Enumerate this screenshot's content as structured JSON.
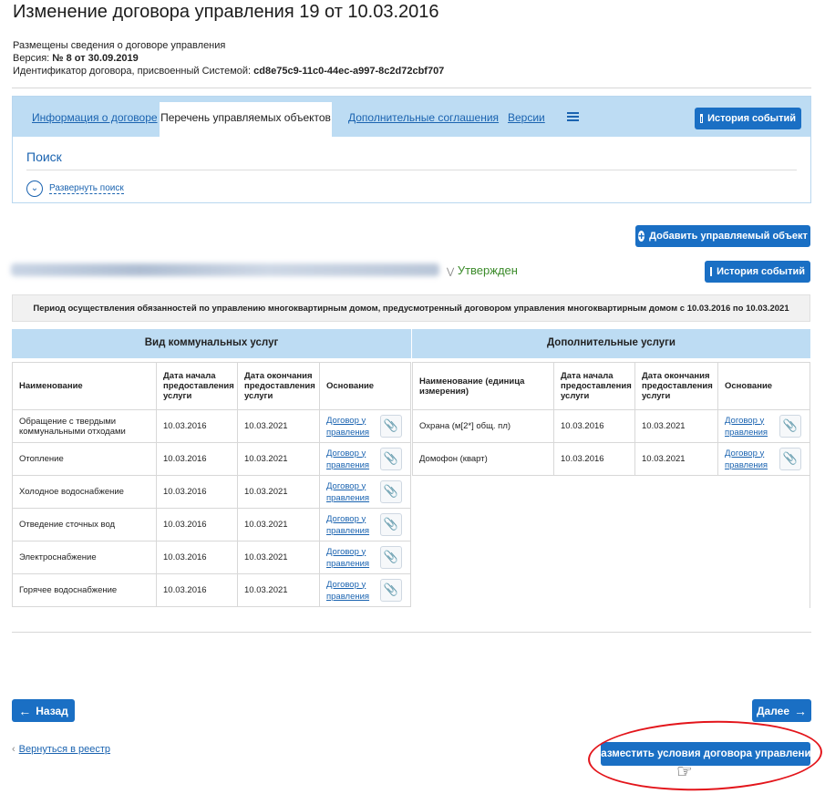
{
  "header": {
    "title": "Изменение договора управления 19 от 10.03.2016",
    "info_line": "Размещены сведения о договоре управления",
    "version_label": "Версия: ",
    "version_value": "№ 8 от 30.09.2019",
    "id_label": "Идентификатор договора, присвоенный Системой: ",
    "id_value": "cd8e75c9-11c0-44ec-a997-8c2d72cbf707"
  },
  "tabs": {
    "info": "Информация о договоре",
    "objects": "Перечень управляемых объектов",
    "agreements": "Дополнительные соглашения",
    "versions": "Версии",
    "history_button": "История событий"
  },
  "search": {
    "title": "Поиск",
    "expand": "Развернуть поиск"
  },
  "objects": {
    "add_button": "Добавить управляемый объект",
    "status": "Утвержден",
    "history_button": "История событий",
    "period": "Период осуществления обязанностей по управлению многоквартирным домом, предусмотренный договором управления многоквартирным домом с 10.03.2016 по 10.03.2021"
  },
  "communal": {
    "title": "Вид коммунальных услуг",
    "columns": [
      "Наименование",
      "Дата начала предоставления услуги",
      "Дата окончания предоставления услуги",
      "Основание"
    ],
    "rows": [
      [
        "Обращение с твердыми коммунальными отходами",
        "10.03.2016",
        "10.03.2021",
        "Договор у правления"
      ],
      [
        "Отопление",
        "10.03.2016",
        "10.03.2021",
        "Договор у правления"
      ],
      [
        "Холодное водоснабжение",
        "10.03.2016",
        "10.03.2021",
        "Договор у правления"
      ],
      [
        "Отведение сточных вод",
        "10.03.2016",
        "10.03.2021",
        "Договор у правления"
      ],
      [
        "Электроснабжение",
        "10.03.2016",
        "10.03.2021",
        "Договор у правления"
      ],
      [
        "Горячее водоснабжение",
        "10.03.2016",
        "10.03.2021",
        "Договор у правления"
      ]
    ]
  },
  "additional": {
    "title": "Дополнительные услуги",
    "columns": [
      "Наименование (единица измерения)",
      "Дата начала предоставления услуги",
      "Дата окончания предоставления услуги",
      "Основание"
    ],
    "rows": [
      [
        "Охрана (м[2*] общ. пл)",
        "10.03.2016",
        "10.03.2021",
        "Договор у правления"
      ],
      [
        "Домофон (кварт)",
        "10.03.2016",
        "10.03.2021",
        "Договор у правления"
      ]
    ]
  },
  "footer": {
    "back": "Назад",
    "next": "Далее",
    "return_link": "Вернуться в реестр",
    "publish": "Разместить условия договора управления"
  },
  "colors": {
    "primary": "#1a6fc4",
    "tab_bar": "#bddcf3",
    "approved": "#3b8b2a",
    "highlight": "#e3151b"
  },
  "icons": [
    "calendar-icon",
    "menu-icon",
    "chevron-down-icon",
    "plus-circle-icon",
    "paperclip-icon",
    "arrow-left-icon",
    "arrow-right-icon",
    "hand-cursor-icon"
  ]
}
